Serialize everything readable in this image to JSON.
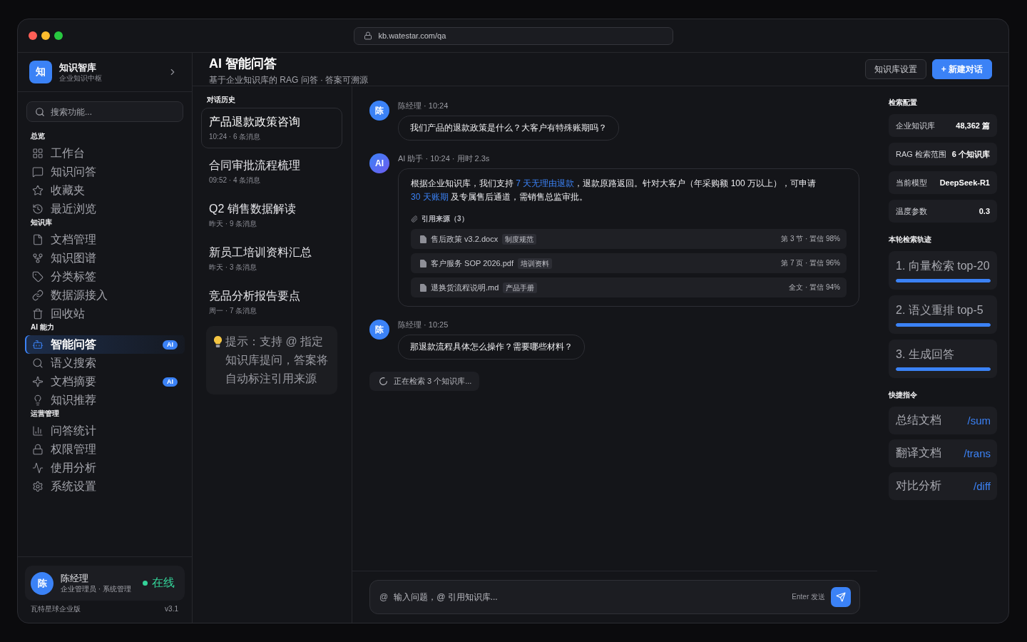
{
  "browser": {
    "url": "kb.watestar.com/qa"
  },
  "sidebar": {
    "brand": {
      "logo": "知",
      "title": "知识智库",
      "subtitle": "企业知识中枢"
    },
    "search": {
      "placeholder": "搜索功能..."
    },
    "sections": [
      {
        "label": "总览",
        "items": [
          {
            "label": "工作台",
            "selected": false
          },
          {
            "label": "知识问答",
            "selected": false
          },
          {
            "label": "收藏夹",
            "selected": false
          },
          {
            "label": "最近浏览",
            "selected": false
          }
        ]
      },
      {
        "label": "知识库",
        "items": [
          {
            "label": "文档管理",
            "selected": false
          },
          {
            "label": "知识图谱",
            "selected": false
          },
          {
            "label": "分类标签",
            "selected": false
          },
          {
            "label": "数据源接入",
            "selected": false
          },
          {
            "label": "回收站",
            "selected": false
          }
        ]
      },
      {
        "label": "AI 能力",
        "items": [
          {
            "label": "智能问答",
            "selected": true,
            "badge": "AI"
          },
          {
            "label": "语义搜索",
            "selected": false
          },
          {
            "label": "文档摘要",
            "selected": false,
            "badge": "AI"
          },
          {
            "label": "知识推荐",
            "selected": false
          }
        ]
      },
      {
        "label": "运营管理",
        "items": [
          {
            "label": "问答统计",
            "selected": false
          },
          {
            "label": "权限管理",
            "selected": false
          },
          {
            "label": "使用分析",
            "selected": false
          },
          {
            "label": "系统设置",
            "selected": false
          }
        ]
      }
    ],
    "user": {
      "avatar": "陈",
      "name": "陈经理",
      "role": "企业管理员 · 系统管理",
      "online": true,
      "status": "在线"
    },
    "footer": {
      "edition": "瓦特星球企业版",
      "version": "v3.1"
    }
  },
  "header": {
    "title": "AI 智能问答",
    "subtitle": "基于企业知识库的 RAG 问答 · 答案可溯源",
    "buttons": [
      {
        "label": "知识库设置",
        "kind": "secondary"
      },
      {
        "label": "+ 新建对话",
        "kind": "primary"
      }
    ]
  },
  "history": {
    "label": "对话历史",
    "items": [
      {
        "title": "产品退款政策咨询",
        "meta": "10:24 · 6 条消息",
        "selected": true
      },
      {
        "title": "合同审批流程梳理",
        "meta": "09:52 · 4 条消息",
        "selected": false
      },
      {
        "title": "Q2 销售数据解读",
        "meta": "昨天 · 9 条消息",
        "selected": false
      },
      {
        "title": "新员工培训资料汇总",
        "meta": "昨天 · 3 条消息",
        "selected": false
      },
      {
        "title": "竞品分析报告要点",
        "meta": "周一 · 7 条消息",
        "selected": false
      }
    ],
    "tip": "提示：支持 @ 指定知识库提问，答案将自动标注引用来源"
  },
  "chat": {
    "messages": [
      {
        "kind": "user",
        "avatar": "陈",
        "meta": "陈经理 · 10:24",
        "text": "我们产品的退款政策是什么？大客户有特殊账期吗？"
      },
      {
        "kind": "assistant",
        "avatar": "AI",
        "meta": "AI 助手 · 10:24 · 用时 2.3s",
        "parts": [
          {
            "kind": "text",
            "text": "根据企业知识库，我们支持 "
          },
          {
            "kind": "link",
            "text": "7 天无理由退款"
          },
          {
            "kind": "text",
            "text": "，退款原路返回。针对大客户（年采购额 100 万以上），可申请 "
          },
          {
            "kind": "link",
            "text": "30 天账期"
          },
          {
            "kind": "text",
            "text": " 及专属售后通道，需销售总监审批。"
          }
        ],
        "sources_label": "引用来源（3）",
        "sources": [
          {
            "name": "售后政策 v3.2.docx",
            "tag": "制度规范",
            "location": "第 3 节 · 置信 98%"
          },
          {
            "name": "客户服务 SOP 2026.pdf",
            "tag": "培训资料",
            "location": "第 7 页 · 置信 96%"
          },
          {
            "name": "退换货流程说明.md",
            "tag": "产品手册",
            "location": "全文 · 置信 94%"
          }
        ]
      },
      {
        "kind": "user",
        "avatar": "陈",
        "meta": "陈经理 · 10:25",
        "text": "那退款流程具体怎么操作？需要哪些材料？"
      }
    ],
    "status": "正在检索 3 个知识库..."
  },
  "composer": {
    "prefix": "@",
    "placeholder": "输入问题，@ 引用知识库...",
    "hint": "Enter 发送"
  },
  "panel": {
    "config": {
      "label": "检索配置",
      "rows": [
        {
          "label": "企业知识库",
          "value": "48,362 篇"
        },
        {
          "label": "RAG 检索范围",
          "value": "6 个知识库"
        },
        {
          "label": "当前模型",
          "value": "DeepSeek-R1"
        },
        {
          "label": "温度参数",
          "value": "0.3"
        }
      ]
    },
    "trace": {
      "label": "本轮检索轨迹",
      "steps": [
        {
          "label": "1. 向量检索 top-20",
          "level": 1
        },
        {
          "label": "2. 语义重排 top-5",
          "level": 1
        },
        {
          "label": "3. 生成回答",
          "level": 1
        }
      ]
    },
    "commands": {
      "label": "快捷指令",
      "items": [
        {
          "label": "总结文档",
          "command": "/sum"
        },
        {
          "label": "翻译文档",
          "command": "/trans"
        },
        {
          "label": "对比分析",
          "command": "/diff"
        }
      ]
    }
  }
}
